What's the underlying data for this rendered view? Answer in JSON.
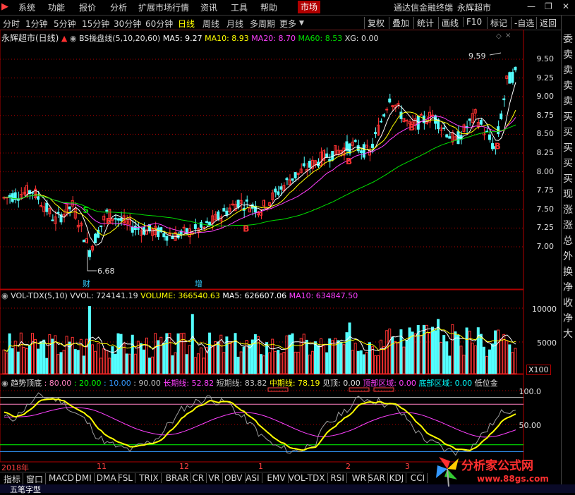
{
  "menu": {
    "items": [
      "系统",
      "功能",
      "报价",
      "分析",
      "扩展市场行情",
      "资讯",
      "工具",
      "帮助"
    ],
    "active": "市场",
    "app_title": "通达信金融终端",
    "stock_title": "永辉超市"
  },
  "periods": {
    "items": [
      "分时",
      "1分钟",
      "5分钟",
      "15分钟",
      "30分钟",
      "60分钟",
      "日线",
      "周线",
      "月线",
      "多周期",
      "更多"
    ],
    "selected": "日线"
  },
  "toolbar": [
    "复权",
    "叠加",
    "统计",
    "画线",
    "F10",
    "标记",
    "-自选",
    "返回"
  ],
  "right_strip": [
    "委",
    "卖",
    "卖",
    "卖",
    "卖",
    "买",
    "买",
    "买",
    "买",
    "买",
    "现",
    "涨",
    "涨",
    "总",
    "外",
    "换",
    "净",
    "收",
    "净",
    "大"
  ],
  "price_panel": {
    "title": "永辉超市(日线)",
    "indicator": "BS操盘线(5,10,20,60)",
    "ma5": "MA5: 9.27",
    "ma10": "MA10: 8.93",
    "ma20": "MA20: 8.70",
    "ma60": "MA60: 8.53",
    "xg": "XG: 0.00",
    "high_label": "9.59",
    "low_label": "6.68",
    "yticks": [
      "9.50",
      "9.25",
      "9.00",
      "8.75",
      "8.50",
      "8.25",
      "8.00",
      "7.75",
      "7.50",
      "7.25",
      "7.00"
    ],
    "markers": {
      "cai": "财",
      "zeng": "增"
    }
  },
  "vol_panel": {
    "title": "VOL-TDX(5,10)",
    "vvol": "VVOL: 724141.19",
    "volume": "VOLUME: 366540.63",
    "ma5": "MA5: 626607.06",
    "ma10": "MA10: 634847.50",
    "yticks": [
      "10000",
      "5000"
    ],
    "unit": "X100"
  },
  "trend_panel": {
    "title": "趋势顶底",
    "v80": ": 80.00",
    "v20": ": 20.00",
    "v10": ": 10.00",
    "v90": ": 90.00",
    "long": "长期线: 52.82",
    "short": "短期线: 83.82",
    "mid": "中期线: 78.19",
    "top": "见顶: 0.00",
    "top_zone": "顶部区域: 0.00",
    "bottom_zone": "底部区域: 0.00",
    "low_zone": "低位金",
    "yticks": [
      "100.0",
      "50.00"
    ]
  },
  "time_axis": {
    "labels": [
      "2018年",
      "11",
      "12",
      "1",
      "2",
      "3"
    ]
  },
  "tabs": [
    "指标",
    "窗口",
    "MACD",
    "DMI",
    "DMA",
    "FSL",
    "TRIX",
    "BRAR",
    "CR",
    "VR",
    "OBV",
    "ASI",
    "EMV",
    "VOL-TDX",
    "RSI",
    "WR",
    "SAR",
    "KDJ",
    "CCI"
  ],
  "status": "五笔字型",
  "logo": {
    "text": "分析家公式网",
    "url": "www.88gs.com"
  },
  "colors": {
    "up": "#ff3232",
    "down": "#54ffff",
    "ma5": "#ffffff",
    "ma10": "#ffff00",
    "ma20": "#ff40ff",
    "ma60": "#00e000",
    "grid": "#b00000"
  }
}
